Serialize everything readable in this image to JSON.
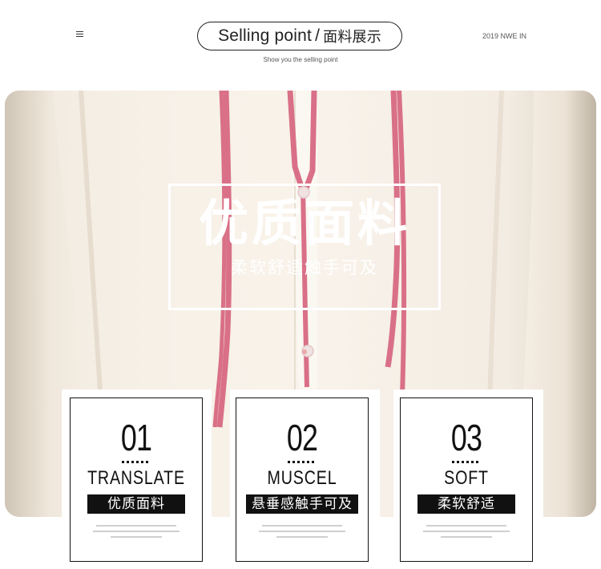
{
  "header": {
    "title_en": "Selling point",
    "title_slash": "/",
    "title_cn": "面料展示",
    "subtitle": "Show you the selling point",
    "year_tag": "2019 NWE IN",
    "menu_icon": "hamburger-icon"
  },
  "hero": {
    "feature_title": "优质面料",
    "feature_subtitle": "柔软舒适触手可及",
    "photo": "cream-blouse-with-pink-ties"
  },
  "cards": [
    {
      "number": "01",
      "english": "TRANSLATE",
      "chinese": "优质面料"
    },
    {
      "number": "02",
      "english": "MUSCEL",
      "chinese": "悬垂感触手可及"
    },
    {
      "number": "03",
      "english": "SOFT",
      "chinese": "柔软舒适"
    }
  ],
  "colors": {
    "ribbon_pink": "#d97088",
    "fabric_cream": "#f6f0e7",
    "ink": "#111111"
  }
}
